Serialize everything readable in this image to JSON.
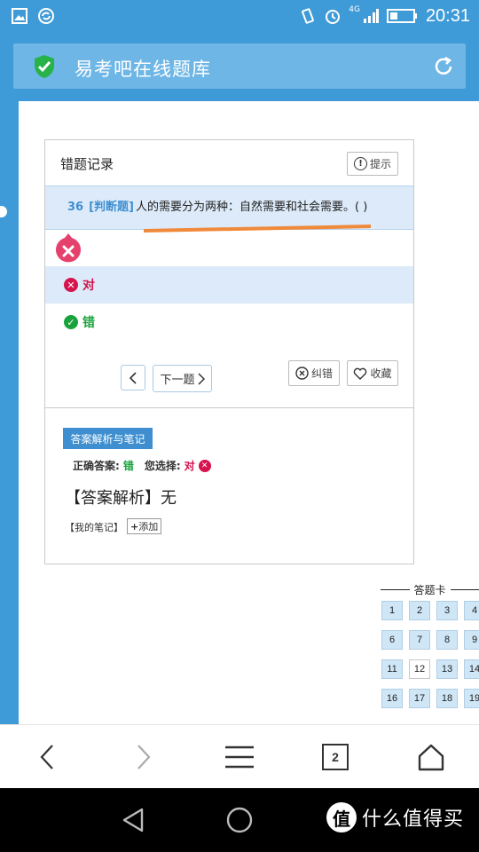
{
  "status_bar": {
    "time": "20:31",
    "network": "4G",
    "left_icons": [
      "image-icon",
      "sync-icon"
    ],
    "right_icons": [
      "vibrate-icon",
      "alarm-icon",
      "signal-icon",
      "battery-icon"
    ]
  },
  "browser": {
    "title": "易考吧在线题库",
    "secure_icon": "shield-check-icon",
    "reload_icon": "reload-icon"
  },
  "card": {
    "title": "错题记录",
    "hint_label": "提示",
    "question": {
      "number": "36",
      "type": "[判断题]",
      "text": "人的需要分为两种：自然需要和社会需要。( )"
    },
    "options": [
      {
        "label": "对",
        "state": "wrong"
      },
      {
        "label": "错",
        "state": "correct"
      }
    ],
    "next_label": "下一题",
    "correct_error_label": "纠错",
    "favorite_label": "收藏"
  },
  "analysis": {
    "tag": "答案解析与笔记",
    "correct_answer_label": "正确答案:",
    "correct_answer": "错",
    "your_choice_label": "您选择:",
    "your_choice": "对",
    "text": "【答案解析】无",
    "notes_label": "【我的笔记】",
    "add_label": "添加"
  },
  "answer_card": {
    "title": "答题卡",
    "numbers": [
      "1",
      "2",
      "3",
      "4",
      "6",
      "7",
      "8",
      "9",
      "11",
      "12",
      "13",
      "14",
      "16",
      "17",
      "18",
      "19"
    ],
    "current": "12"
  },
  "colors": {
    "brand_blue": "#3f9bd8",
    "wrong_red": "#d6134d",
    "correct_green": "#1aa33c",
    "highlight_band": "#dceaf9",
    "annotation_orange": "#f0893a"
  },
  "watermark": {
    "logo": "值",
    "text": "什么值得买"
  }
}
